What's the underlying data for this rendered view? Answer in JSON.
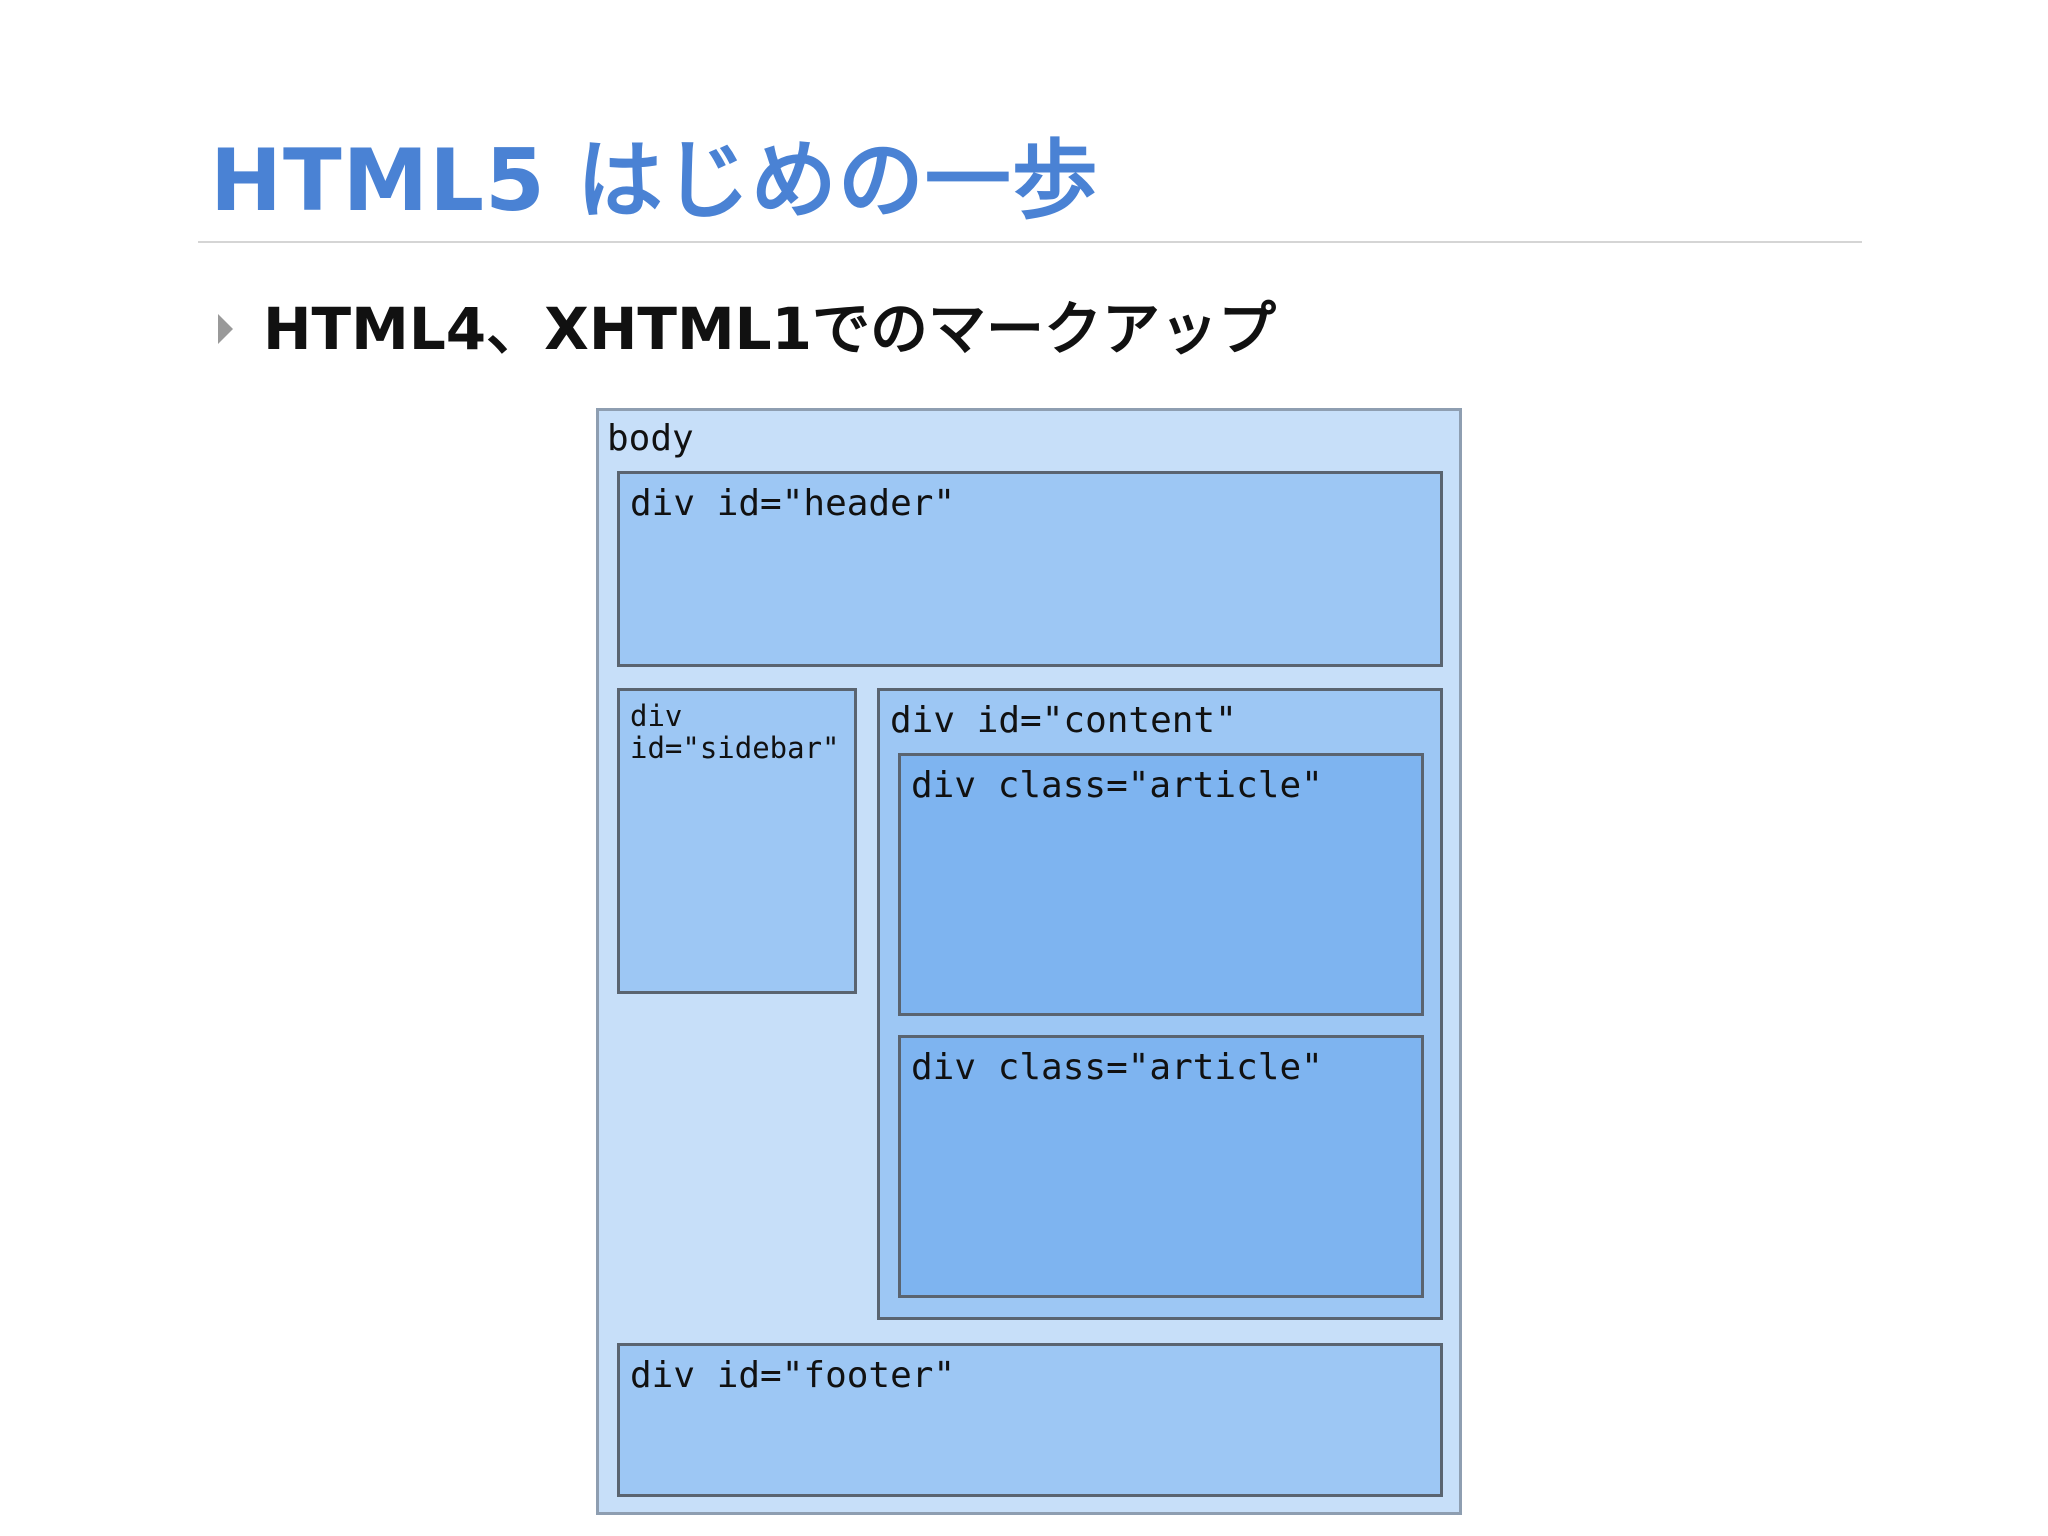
{
  "slide": {
    "title": "HTML5 はじめの一歩",
    "bullet": "HTML4、XHTML1でのマークアップ"
  },
  "diagram": {
    "body_label": "body",
    "header_label": "div id=\"header\"",
    "sidebar_label": "div\nid=\"sidebar\"",
    "content_label": "div id=\"content\"",
    "article1_label": "div class=\"article\"",
    "article2_label": "div class=\"article\"",
    "footer_label": "div id=\"footer\""
  },
  "colors": {
    "title": "#4a82d4",
    "body_fill": "#c7dff9",
    "div_fill": "#9dc7f4",
    "article_fill": "#7eb4f0"
  },
  "icons": {
    "bullet": "triangle-right-icon"
  }
}
